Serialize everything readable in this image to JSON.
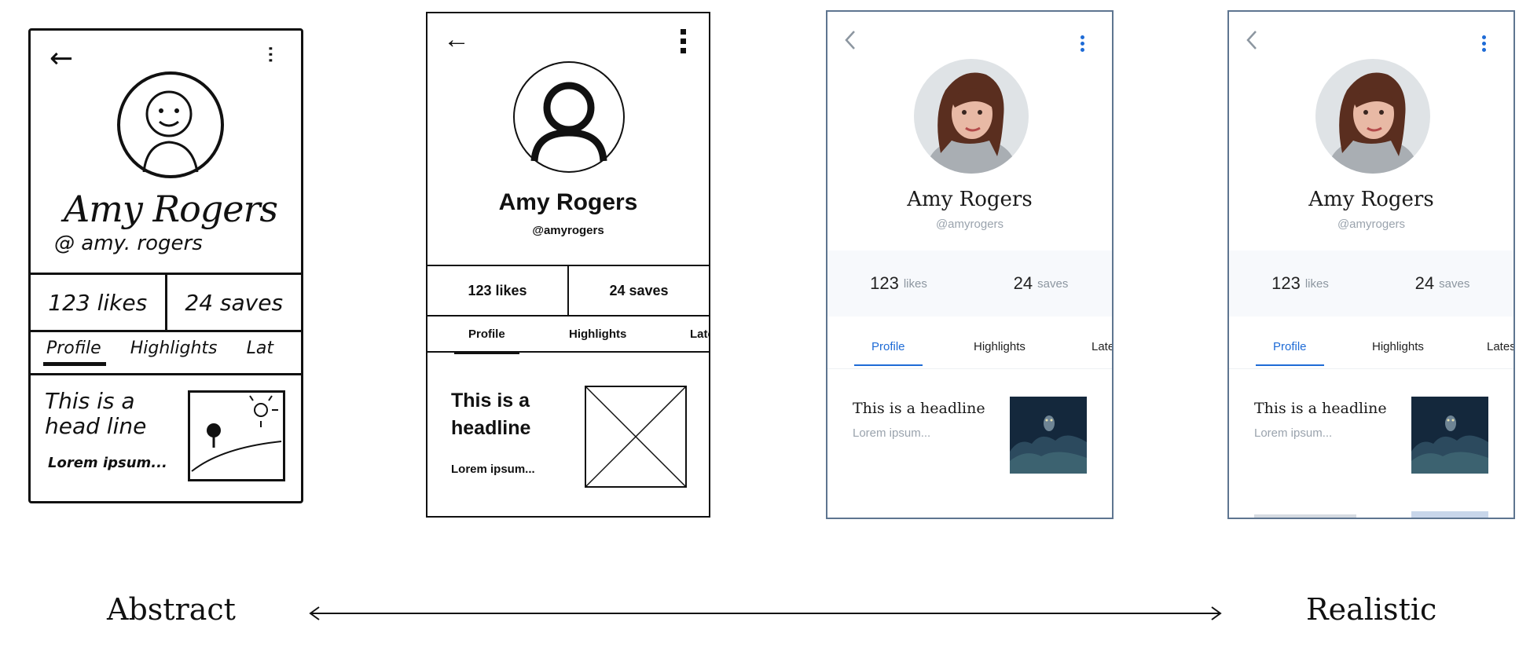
{
  "profile": {
    "name": "Amy Rogers",
    "sketch_handle": "@ amy. rogers",
    "handle": "@amyrogers",
    "sketch_likes": "123 likes",
    "sketch_saves": "24 saves",
    "likes_label": "123 likes",
    "saves_label": "24 saves",
    "likes_number": "123",
    "likes_unit": "likes",
    "saves_number": "24",
    "saves_unit": "saves",
    "tabs": [
      "Profile",
      "Highlights",
      "Latest"
    ],
    "sketch_tabs": [
      "Profile",
      "Highlights",
      "Lat"
    ],
    "headline": "This is a headline",
    "sketch_headline": "This is a head line",
    "lorem": "Lorem ipsum...",
    "sketch_lorem": "Lorem ipsum..."
  },
  "icons": {
    "back": "arrow-left-icon",
    "more": "more-vertical-icon",
    "avatar": "avatar-icon",
    "image_placeholder": "image-placeholder-icon"
  },
  "colors": {
    "accent": "#1e6bd6",
    "frame_border": "#5e7590",
    "muted_text": "#9aa3ad"
  },
  "axis": {
    "left_label": "Abstract",
    "right_label": "Realistic"
  }
}
